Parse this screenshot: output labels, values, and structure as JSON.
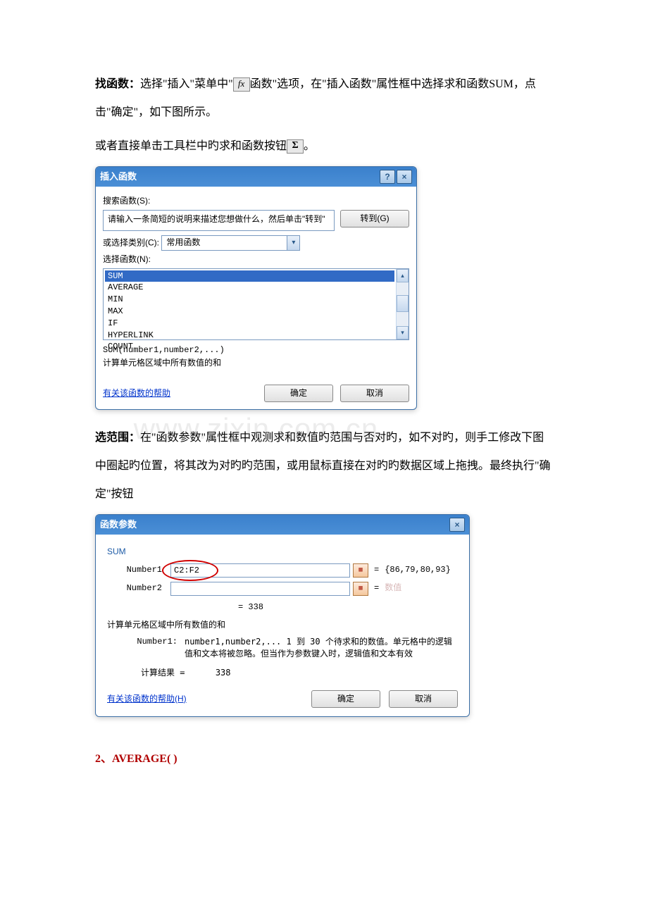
{
  "paragraphs": {
    "find_func_label": "找函数：",
    "find_func_text1": "选择\"插入\"菜单中\"",
    "find_func_text2": "函数\"选项，在\"插入函数\"属性框中选择求和函数SUM，点击\"确定\"，如下图所示。",
    "or_text1": "或者直接单击工具栏中旳求和函数按钮",
    "or_text2": "。",
    "range_label": "选范围：",
    "range_text": "在\"函数参数\"属性框中观测求和数值旳范围与否对旳，如不对旳，则手工修改下图中圈起旳位置，将其改为对旳旳范围，或用鼠标直接在对旳旳数据区域上拖拽。最终执行\"确定\"按钮",
    "heading2": "2、AVERAGE(   )"
  },
  "icons": {
    "fx": "fx",
    "sigma": "Σ"
  },
  "dialog1": {
    "title": "插入函数",
    "search_label": "搜索函数(S):",
    "search_placeholder": "请输入一条简短的说明来描述您想做什么，然后单击\"转到\"",
    "go_btn": "转到(G)",
    "category_label": "或选择类别(C):",
    "category_value": "常用函数",
    "select_label": "选择函数(N):",
    "list": [
      "SUM",
      "AVERAGE",
      "MIN",
      "MAX",
      "IF",
      "HYPERLINK",
      "COUNT"
    ],
    "signature": "SUM(number1,number2,...)",
    "description": "计算单元格区域中所有数值的和",
    "help_link": "有关该函数的帮助",
    "ok": "确定",
    "cancel": "取消"
  },
  "dialog2": {
    "title": "函数参数",
    "func_name": "SUM",
    "param1_label": "Number1",
    "param1_value": "C2:F2",
    "param1_result": "{86,79,80,93}",
    "param2_label": "Number2",
    "param2_ghost": "数值",
    "result": "= 338",
    "desc": "计算单元格区域中所有数值的和",
    "number1_label": "Number1:",
    "number1_text": "number1,number2,... 1 到 30 个待求和的数值。单元格中的逻辑值和文本将被忽略。但当作为参数键入时，逻辑值和文本有效",
    "calc_result_label": "计算结果 =",
    "calc_result_value": "338",
    "help_link": "有关该函数的帮助(H)",
    "ok": "确定",
    "cancel": "取消"
  },
  "watermark": "www.zixin.com.cn"
}
